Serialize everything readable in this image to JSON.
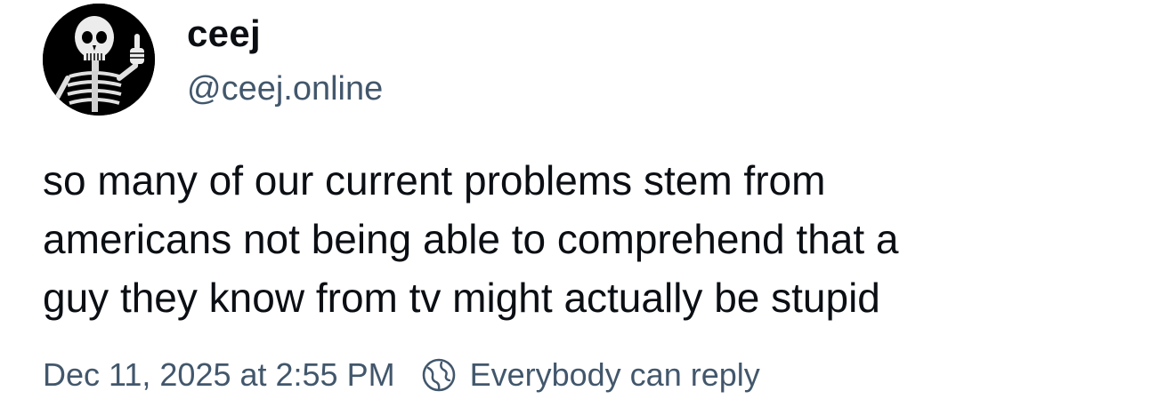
{
  "author": {
    "display_name": "ceej",
    "handle": "@ceej.online",
    "avatar_icon": "skeleton-thumbs-up-avatar"
  },
  "post": {
    "text": "so many of our current problems stem from\namericans not being able to comprehend that a\nguy they know from tv might actually be stupid"
  },
  "meta": {
    "timestamp": "Dec 11, 2025 at 2:55 PM",
    "reply_setting": "Everybody can reply",
    "reply_icon": "globe-icon"
  },
  "colors": {
    "text_primary": "#0b0f14",
    "text_secondary": "#42576c",
    "background": "#ffffff"
  }
}
